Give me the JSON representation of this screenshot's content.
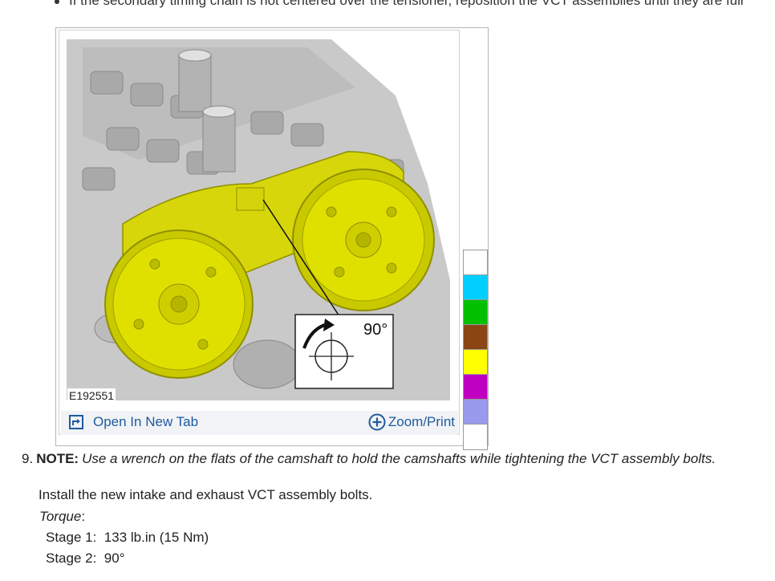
{
  "bullet": {
    "text": "If the secondary timing chain is not centered over the tensioner, reposition the VCT assemblies until they are full"
  },
  "figure": {
    "id_label": "E192551",
    "callout_angle": "90°",
    "open_tab_label": "Open In New Tab",
    "zoom_label": "Zoom/Print",
    "swatch_colors": [
      "#ffffff",
      "#00cfff",
      "#00c000",
      "#8b4513",
      "#ffff00",
      "#c000c0",
      "#9999ee",
      "#ffffff"
    ]
  },
  "step": {
    "number": "9.",
    "note_label": "NOTE:",
    "note_text": "Use a wrench on the flats of the camshaft to hold the camshafts while tightening the VCT assembly bolts.",
    "instruction": "Install the new intake and exhaust VCT assembly bolts.",
    "torque_label": "Torque",
    "torque_colon": ":",
    "stages": [
      {
        "label": "Stage 1:",
        "value": "133 lb.in (15 Nm)"
      },
      {
        "label": "Stage 2:",
        "value": "90°"
      }
    ]
  }
}
